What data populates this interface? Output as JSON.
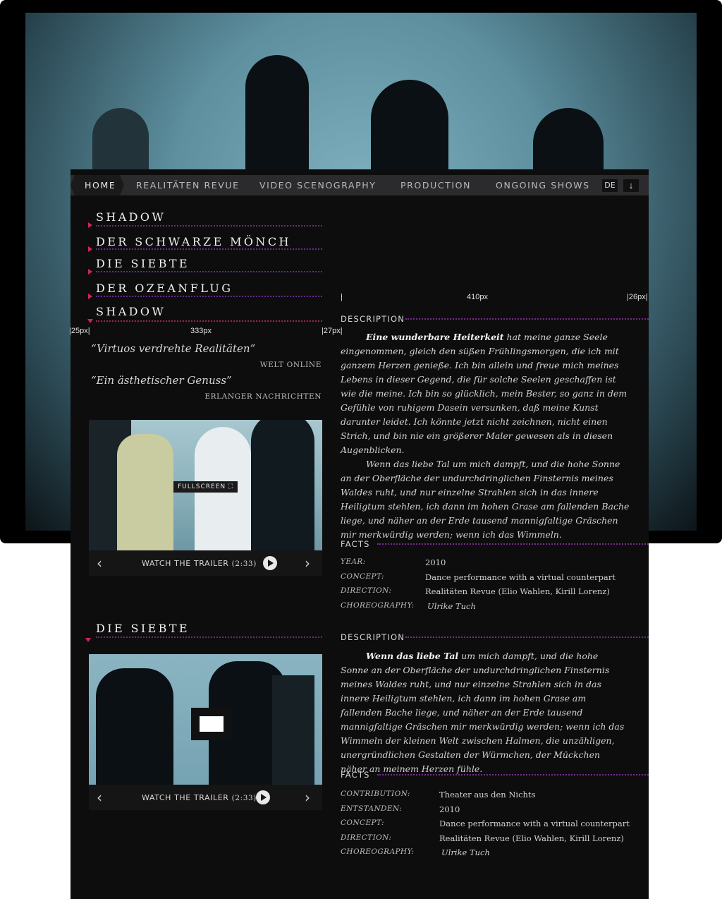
{
  "nav": {
    "home": "HOME",
    "items": [
      "REALITÄTEN REVUE",
      "VIDEO SCENOGRAPHY",
      "PRODUCTION",
      "ONGOING SHOWS"
    ],
    "lang": "DE",
    "arrow_icon": "arrow-down-icon"
  },
  "projects": [
    "SHADOW",
    "DER SCHWARZE MÖNCH",
    "DIE SIEBTE",
    "DER OZEANFLUG",
    "SHADOW"
  ],
  "measures": {
    "left_margin": "|25px|",
    "left_col": "333px",
    "gutter": "|27px|",
    "right_col": "410px",
    "right_margin": "|26px|",
    "right_start": "|"
  },
  "quotes": [
    {
      "text": "“Virtuos verdrehte Realitäten”",
      "source": "WELT ONLINE"
    },
    {
      "text": "“Ein ästhetischer Genuss”",
      "source": "ERLANGER NACHRICHTEN"
    }
  ],
  "video1": {
    "fullscreen_label": "FULLSCREEN",
    "trailer_label": "WATCH THE TRAILER",
    "duration": "(2:33)"
  },
  "section1": {
    "description_heading": "DESCRIPTION",
    "lead": "Eine wunderbare Heiterkeit",
    "p1": " hat meine ganze Seele eingenommen, gleich den süßen Frühlingsmorgen, die ich mit ganzem Herzen genieße. Ich bin allein und freue mich meines Lebens in dieser Gegend, die für solche Seelen geschaffen ist wie die meine. Ich bin so glücklich, mein Bester, so ganz in dem Gefühle von ruhigem Dasein versunken, daß meine Kunst darunter leidet. Ich könnte jetzt nicht zeichnen, nicht einen Strich, und bin nie ein größerer Maler gewesen als in diesen Augenblicken.",
    "p2": "Wenn das liebe Tal um mich dampft, und die hohe Sonne an der Oberfläche der undurchdringlichen Finsternis meines Waldes ruht, und nur einzelne Strahlen sich in das innere Heiligtum stehlen, ich dann im hohen Grase am fallenden Bache liege, und näher an der Erde tausend mannigfaltige Gräschen mir merkwürdig werden; wenn ich das Wimmeln.",
    "facts_heading": "FACTS",
    "facts": [
      {
        "k": "YEAR:",
        "v": "2010"
      },
      {
        "k": "CONCEPT:",
        "v": "Dance performance with a virtual counterpart"
      },
      {
        "k": "DIRECTION:",
        "v": "Realitäten Revue (Elio Wahlen, Kirill Lorenz)"
      },
      {
        "k": "CHOREOGRAPHY:",
        "v": "Ulrike Tuch"
      }
    ]
  },
  "section2": {
    "title": "DIE SIEBTE",
    "description_heading": "DESCRIPTION",
    "lead": "Wenn das liebe Tal",
    "p1": " um mich dampft, und die hohe Sonne an der Oberfläche der undurchdringlichen Finsternis meines Waldes ruht, und nur einzelne Strahlen sich in das innere Heiligtum stehlen, ich dann im hohen Grase am fallenden Bache liege, und näher an der Erde tausend mannigfaltige Gräschen mir merkwürdig werden; wenn ich das Wimmeln der kleinen Welt zwischen Halmen, die unzähligen, unergründlichen Gestalten der Würmchen, der Mückchen näher an meinem Herzen fühle.",
    "facts_heading": "FACTS",
    "facts": [
      {
        "k": "CONTRIBUTION:",
        "v": "Theater aus den Nichts"
      },
      {
        "k": "ENTSTANDEN:",
        "v": "2010"
      },
      {
        "k": "CONCEPT:",
        "v": "Dance performance with a virtual counterpart"
      },
      {
        "k": "DIRECTION:",
        "v": "Realitäten Revue (Elio Wahlen, Kirill Lorenz)"
      },
      {
        "k": "CHOREOGRAPHY:",
        "v": "Ulrike Tuch"
      }
    ]
  },
  "video2": {
    "trailer_label": "WATCH THE TRAILER",
    "duration": "(2:33)"
  },
  "colors": {
    "accent_pink": "#d3245a",
    "accent_purple": "#6b2a8e",
    "panel_bg": "#0d0d0e",
    "nav_bg": "#2b2b2d"
  }
}
